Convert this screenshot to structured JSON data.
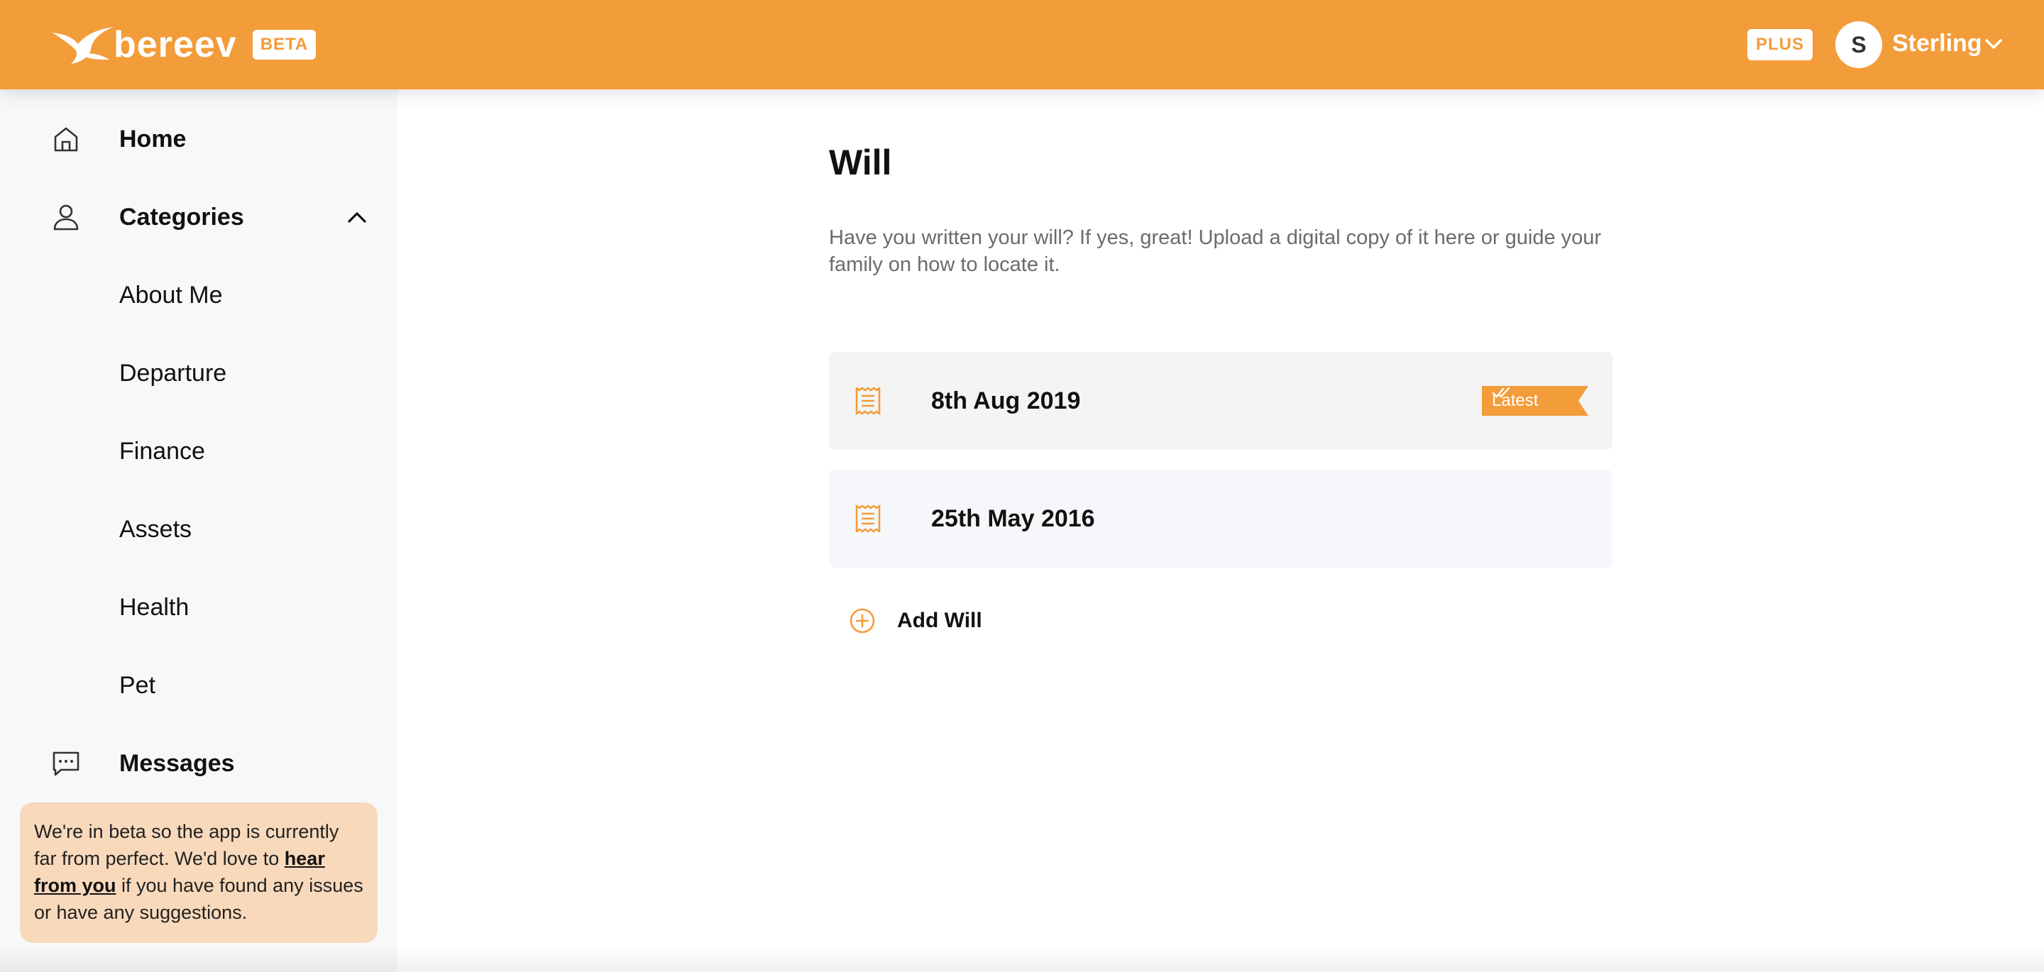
{
  "header": {
    "logo_text": "bereev",
    "beta_label": "BETA",
    "plus_label": "PLUS",
    "user_initial": "S",
    "user_name": "Sterling",
    "accent_color": "#f39c3a"
  },
  "sidebar": {
    "items": [
      {
        "label": "Home",
        "icon": "home-icon"
      },
      {
        "label": "Categories",
        "icon": "user-icon"
      },
      {
        "label": "About Me"
      },
      {
        "label": "Departure"
      },
      {
        "label": "Finance"
      },
      {
        "label": "Assets"
      },
      {
        "label": "Health"
      },
      {
        "label": "Pet"
      },
      {
        "label": "Messages",
        "icon": "message-icon"
      }
    ],
    "beta_note": {
      "text_before": "We're in beta so the app is currently far from perfect. We'd love to ",
      "link_text": "hear from you",
      "text_after": " if you have found any issues or have any suggestions."
    }
  },
  "main": {
    "title": "Will",
    "description": "Have you written your will? If yes, great! Upload a digital copy of it here or guide your family on how to locate it.",
    "wills": [
      {
        "date": "8th Aug 2019",
        "tag": "Latest"
      },
      {
        "date": "25th May 2016"
      }
    ],
    "add_label": "Add Will"
  }
}
